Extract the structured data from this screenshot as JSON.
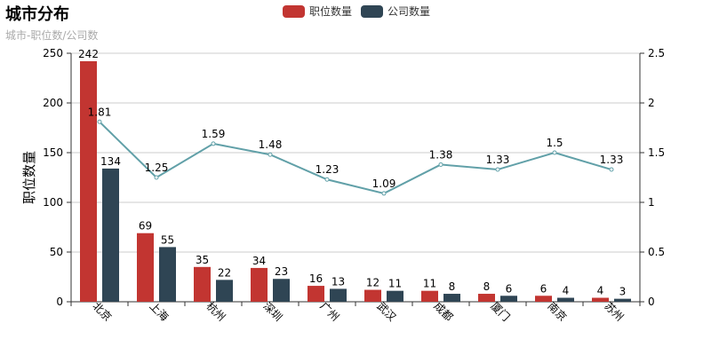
{
  "chart_data": {
    "type": "bar",
    "title": "城市分布",
    "subtitle": "城市-职位数/公司数",
    "categories": [
      "北京",
      "上海",
      "杭州",
      "深圳",
      "广州",
      "武汉",
      "成都",
      "厦门",
      "南京",
      "苏州"
    ],
    "series": [
      {
        "name": "职位数量",
        "type": "bar",
        "axis": "left",
        "color": "#c23531",
        "values": [
          242,
          69,
          35,
          34,
          16,
          12,
          11,
          8,
          6,
          4
        ]
      },
      {
        "name": "公司数量",
        "type": "bar",
        "axis": "left",
        "color": "#2f4554",
        "values": [
          134,
          55,
          22,
          23,
          13,
          11,
          8,
          6,
          4,
          3
        ]
      },
      {
        "type": "line",
        "axis": "right",
        "color": "#61a0a8",
        "values": [
          1.81,
          1.25,
          1.59,
          1.48,
          1.23,
          1.09,
          1.38,
          1.33,
          1.5,
          1.33
        ]
      }
    ],
    "ylabel": "职位数量",
    "ylim": [
      0,
      250
    ],
    "yticks": [
      "0",
      "50",
      "100",
      "150",
      "200",
      "250"
    ],
    "y2lim": [
      0,
      2.5
    ],
    "y2ticks": [
      "0",
      "0.5",
      "1",
      "1.5",
      "2",
      "2.5"
    ],
    "grid": true,
    "legend_position": "top-center"
  }
}
